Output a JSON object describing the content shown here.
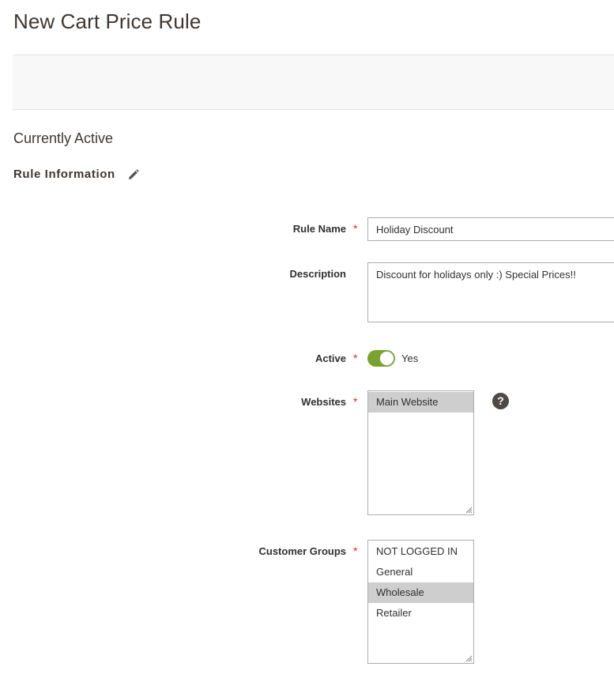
{
  "page": {
    "title": "New Cart Price Rule"
  },
  "status": {
    "heading": "Currently Active"
  },
  "section": {
    "title": "Rule Information",
    "edit_icon": "pencil-icon"
  },
  "form": {
    "rule_name": {
      "label": "Rule Name",
      "value": "Holiday Discount",
      "required": "*"
    },
    "description": {
      "label": "Description",
      "value": "Discount for holidays only :) Special Prices!!"
    },
    "active": {
      "label": "Active",
      "required": "*",
      "state_label": "Yes",
      "on": true
    },
    "websites": {
      "label": "Websites",
      "required": "*",
      "help_icon": "?",
      "options": [
        {
          "label": "Main Website",
          "selected": true
        }
      ]
    },
    "customer_groups": {
      "label": "Customer Groups",
      "required": "*",
      "options": [
        {
          "label": "NOT LOGGED IN",
          "selected": false
        },
        {
          "label": "General",
          "selected": false
        },
        {
          "label": "Wholesale",
          "selected": true
        },
        {
          "label": "Retailer",
          "selected": false
        }
      ]
    }
  },
  "colors": {
    "toggle_on": "#79a22e",
    "required": "#e22626",
    "selected_option": "#cecece"
  }
}
